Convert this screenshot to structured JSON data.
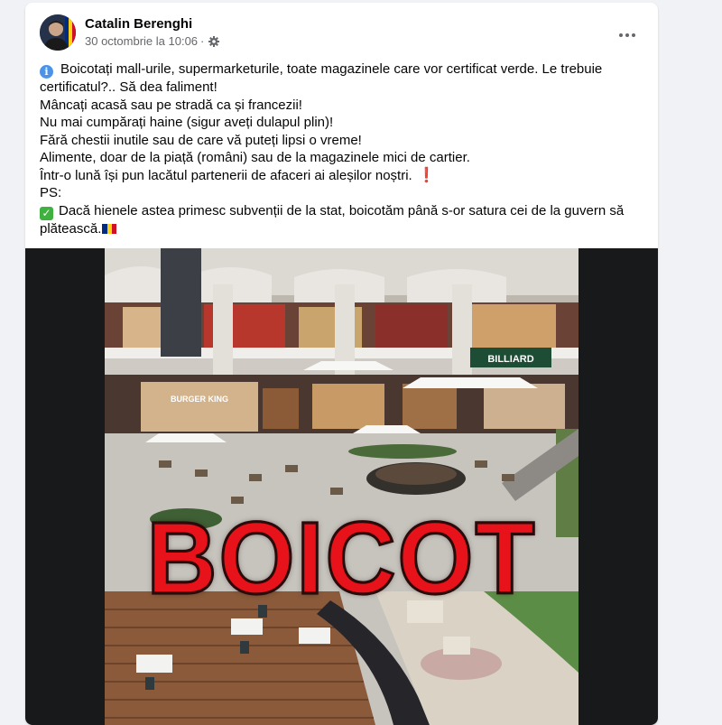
{
  "post": {
    "author": "Catalin Berenghi",
    "timestamp": "30 octombrie la 10:06",
    "separator": "·",
    "audience_icon": "gear-icon",
    "more_icon": "more-options-icon",
    "lines": {
      "l1": "Boicotați mall-urile, supermarketurile, toate magazinele care vor certificat verde. Le trebuie",
      "l2": "certificatul?.. Să dea faliment!",
      "l3": "Mâncați acasă sau pe stradă ca și francezii!",
      "l4": "Nu mai cumpărați haine (sigur aveți dulapul plin)!",
      "l5": "Fără chestii inutile sau de care vă puteți lipsi o vreme!",
      "l6": "Alimente, doar de la piață (români) sau de la magazinele mici de cartier.",
      "l7": "Într-o lună își pun lacătul partenerii de afaceri ai aleșilor noștri.",
      "l8": "PS:",
      "l9": "Dacă hienele astea primesc subvenții de la stat, boicotăm până s-or satura cei de la guvern să",
      "l10": "plătească."
    },
    "exclamation_emoji": "❗",
    "info_emoji": "i",
    "check_emoji": "✓"
  },
  "image": {
    "overlay_text": "BOICOT",
    "sign_burger_king": "BURGER KING",
    "sign_billiard": "BILLIARD"
  },
  "colors": {
    "page_bg": "#f0f2f5",
    "card_bg": "#ffffff",
    "text": "#050505",
    "secondary_text": "#65676b",
    "boicot_red": "#e8121a",
    "flag": [
      "#002b7f",
      "#fcd116",
      "#ce1126"
    ]
  }
}
